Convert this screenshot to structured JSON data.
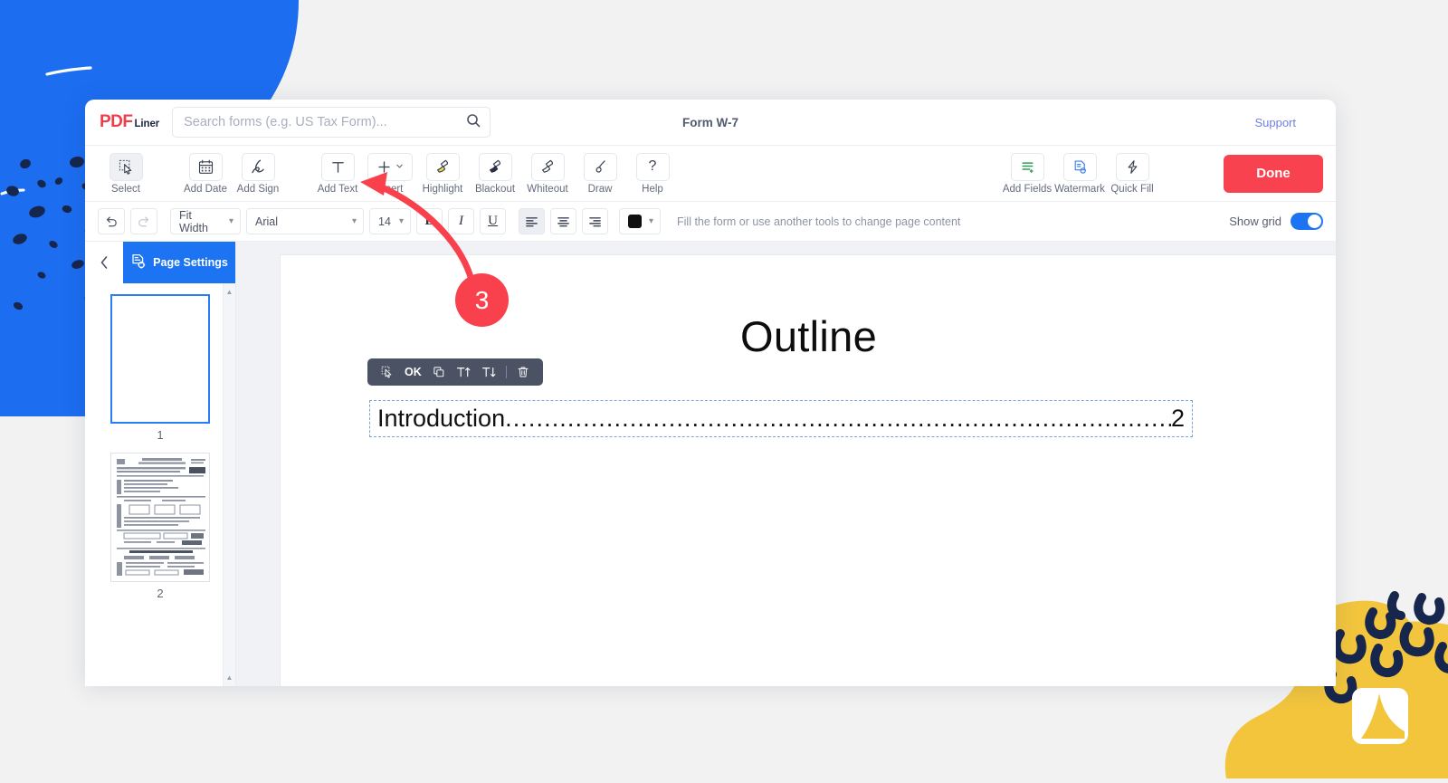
{
  "brand": {
    "logo_mark": "PDF",
    "logo_suffix": "Liner",
    "accent_red": "#F9424F",
    "accent_blue": "#1C74F2",
    "accent_yellow": "#F2C53D",
    "accent_navy": "#16264C"
  },
  "header": {
    "title": "Form W-7",
    "support_label": "Support",
    "search": {
      "placeholder": "Search forms (e.g. US Tax Form)...",
      "value": "",
      "icon": "search-icon"
    }
  },
  "toolbar": {
    "tools": [
      {
        "label": "Select",
        "icon": "cursor-select-icon",
        "active": true
      },
      {
        "label": "Add Date",
        "icon": "calendar-icon",
        "active": false
      },
      {
        "label": "Add Sign",
        "icon": "signature-pen-icon",
        "active": false
      },
      {
        "label": "Add Text",
        "icon": "text-t-icon",
        "active": false
      },
      {
        "label": "Insert",
        "icon": "plus-icon",
        "active": false,
        "has_caret": true
      },
      {
        "label": "Highlight",
        "icon": "highlighter-icon",
        "active": false
      },
      {
        "label": "Blackout",
        "icon": "blackout-brush-icon",
        "active": false
      },
      {
        "label": "Whiteout",
        "icon": "whiteout-brush-icon",
        "active": false
      },
      {
        "label": "Draw",
        "icon": "draw-pen-icon",
        "active": false
      },
      {
        "label": "Help",
        "icon": "question-mark-icon",
        "active": false
      }
    ],
    "right_tools": [
      {
        "label": "Add Fields",
        "icon": "add-fields-icon"
      },
      {
        "label": "Watermark",
        "icon": "watermark-icon"
      },
      {
        "label": "Quick Fill",
        "icon": "lightning-bolt-icon"
      }
    ],
    "done_label": "Done"
  },
  "format_bar": {
    "undo_icon": "undo-arrow-icon",
    "redo_icon": "redo-arrow-icon",
    "zoom_value": "Fit Width",
    "font_family_value": "Arial",
    "font_size_value": "14",
    "bold_label": "B",
    "italic_label": "I",
    "underline_label": "U",
    "align_left_icon": "align-left-icon",
    "align_center_icon": "align-center-icon",
    "align_right_icon": "align-right-icon",
    "active_align": "left",
    "text_color": "#101010",
    "hint": "Fill the form or use another tools to change page content",
    "show_grid_label": "Show grid",
    "show_grid_on": true
  },
  "sidebar": {
    "collapse_icon": "chevron-left-icon",
    "page_settings_label": "Page Settings",
    "page_settings_icon": "page-settings-icon",
    "pages": [
      {
        "number": "1",
        "selected": true,
        "kind": "blank"
      },
      {
        "number": "2",
        "selected": false,
        "kind": "form"
      }
    ],
    "scroll_up_icon": "scroll-up-arrow-icon",
    "scroll_down_icon": "scroll-down-arrow-icon"
  },
  "document": {
    "heading": "Outline",
    "text_box": {
      "label": "Introduction",
      "leader": "..................................................................................................................",
      "page_ref": "2",
      "selected": true
    },
    "float_toolbar": [
      {
        "icon": "cursor-select-icon",
        "label": ""
      },
      {
        "icon": "ok-icon",
        "label": "OK"
      },
      {
        "icon": "duplicate-icon",
        "label": ""
      },
      {
        "icon": "font-increase-icon",
        "label": ""
      },
      {
        "icon": "font-decrease-icon",
        "label": ""
      },
      {
        "icon": "divider",
        "label": ""
      },
      {
        "icon": "trash-icon",
        "label": ""
      }
    ]
  },
  "annotation": {
    "step_number": "3",
    "color": "#F9414E",
    "points_to": "Insert"
  }
}
